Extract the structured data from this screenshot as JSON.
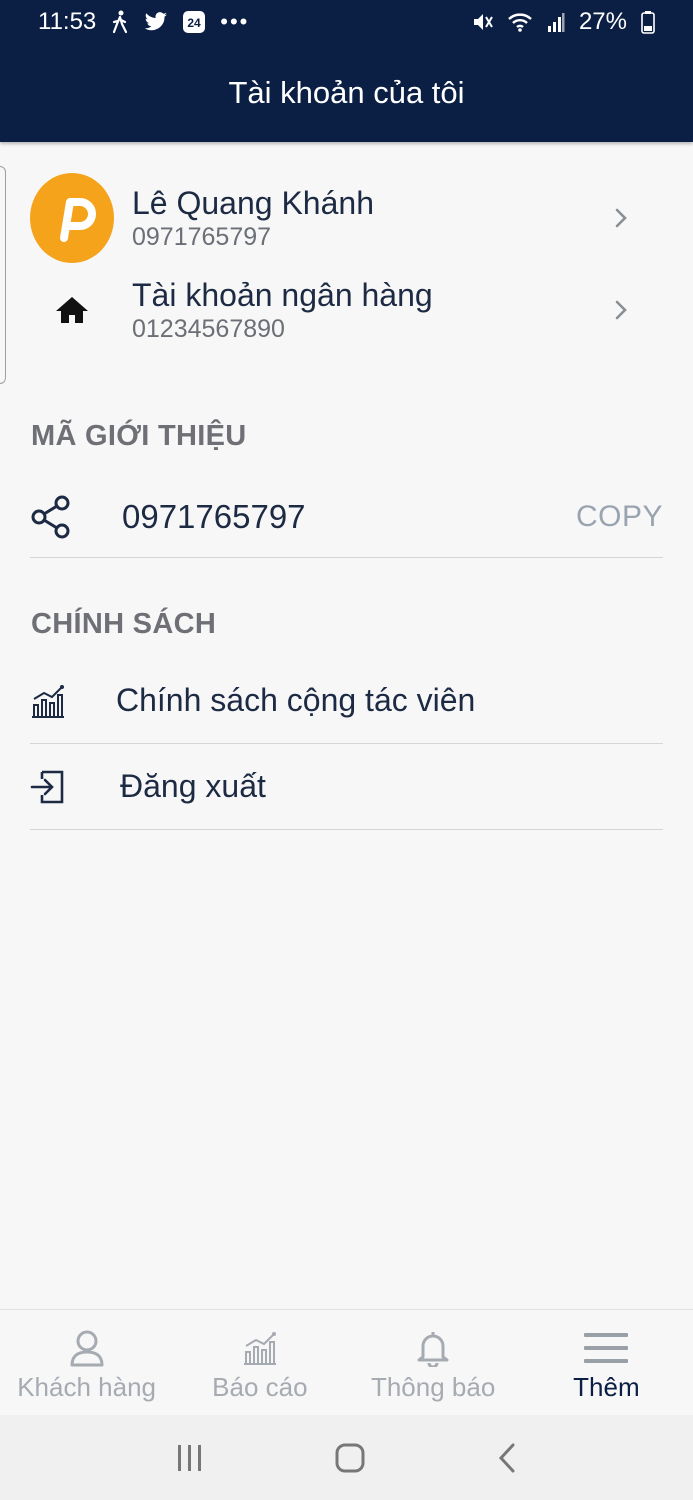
{
  "status_bar": {
    "time": "11:53",
    "battery": "27%",
    "icons": [
      "walking-icon",
      "twitter-icon",
      "news24-icon",
      "more-dots-icon",
      "mute-icon",
      "wifi-icon",
      "signal-icon",
      "battery-icon"
    ]
  },
  "header": {
    "title": "Tài khoản của tôi"
  },
  "profile": {
    "name": "Lê Quang Khánh",
    "phone": "0971765797",
    "avatar_letter": "P",
    "avatar_color": "#f5a31a"
  },
  "bank": {
    "label": "Tài khoản ngân hàng",
    "number": "01234567890"
  },
  "referral": {
    "section_title": "MÃ GIỚI THIỆU",
    "code": "0971765797",
    "copy_label": "COPY"
  },
  "policy": {
    "section_title": "CHÍNH SÁCH",
    "items": [
      {
        "label": "Chính sách cộng tác viên",
        "icon": "chart-icon"
      },
      {
        "label": "Đăng xuất",
        "icon": "logout-icon"
      }
    ]
  },
  "bottom_nav": {
    "items": [
      {
        "label": "Khách hàng",
        "icon": "user-icon"
      },
      {
        "label": "Báo cáo",
        "icon": "chart-icon"
      },
      {
        "label": "Thông báo",
        "icon": "bell-icon"
      },
      {
        "label": "Thêm",
        "icon": "menu-icon",
        "active": true
      }
    ]
  },
  "colors": {
    "header_bg": "#0b1f45",
    "accent_orange": "#f5a31a",
    "inactive_nav": "#a6abb2"
  }
}
